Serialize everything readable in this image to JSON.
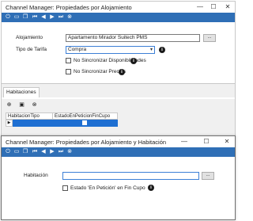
{
  "main_window": {
    "title": "Channel Manager: Propiedades por Alojamiento",
    "controls": {
      "minimize": "—",
      "maximize": "☐",
      "close": "✕"
    },
    "toolbar_icons": [
      "power-icon",
      "save-icon",
      "copy-icon",
      "first-icon",
      "previous-icon",
      "next-icon",
      "last-icon",
      "close-icon"
    ],
    "form": {
      "alojamiento_label": "Alojamiento",
      "alojamiento_value": "Apartamento Mirador Suitech PMS",
      "ellipsis_label": "...",
      "tipo_tarifa_label": "Tipo de Tarifa",
      "tipo_tarifa_value": "Compra",
      "no_sincronizar_disponibilidades": "No Sincronizar Disponibilidades",
      "no_sincronizar_precios": "No Sincronizar Precios",
      "info_glyph": "i"
    },
    "tabs": [
      "Habitaciones"
    ],
    "grid": {
      "columns": [
        "HabitacionTipo",
        "EstadoEnPeticionFinCupo"
      ],
      "row_marker": "▶"
    }
  },
  "dialog_window": {
    "title": "Channel Manager: Propiedades por Alojamiento y Habitación",
    "controls": {
      "minimize": "—",
      "maximize": "☐",
      "close": "✕"
    },
    "form": {
      "habitacion_label": "Habitación",
      "habitacion_value": "",
      "ellipsis_label": "...",
      "estado_checkbox_label": "Estado 'En Petición' en Fin Cupo",
      "info_glyph": "i"
    }
  },
  "colors": {
    "toolbar": "#2f6fb6",
    "grid_selected_row": "#1e6fd2",
    "panel_gray": "#f0f0f0"
  }
}
